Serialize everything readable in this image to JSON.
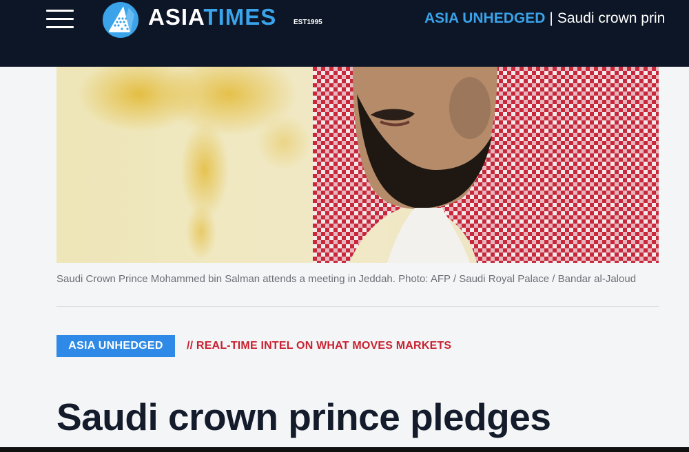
{
  "header": {
    "menu_icon": "hamburger-menu-icon",
    "logo_icon": "asia-times-globe-logo",
    "logo_word_1": "ASIA",
    "logo_word_2": "TIMES",
    "logo_est": "EST1995",
    "section": "ASIA UNHEDGED",
    "separator": "|",
    "title": "Saudi crown prin"
  },
  "article": {
    "image_alt": "Saudi Crown Prince Mohammed bin Salman wearing a red-and-white checked ghutra",
    "caption": "Saudi Crown Prince Mohammed bin Salman attends a meeting in Jeddah. Photo: AFP / Saudi Royal Palace / Bandar al-Jaloud",
    "badge": "ASIA UNHEDGED",
    "tagline": "// REAL-TIME INTEL ON WHAT MOVES MARKETS",
    "headline": "Saudi crown prince pledges"
  },
  "colors": {
    "topbar": "#0d1626",
    "brand_blue": "#3aa3ea",
    "badge_blue": "#2e8ae6",
    "tagline_red": "#c8202f",
    "headline": "#141c2c"
  }
}
